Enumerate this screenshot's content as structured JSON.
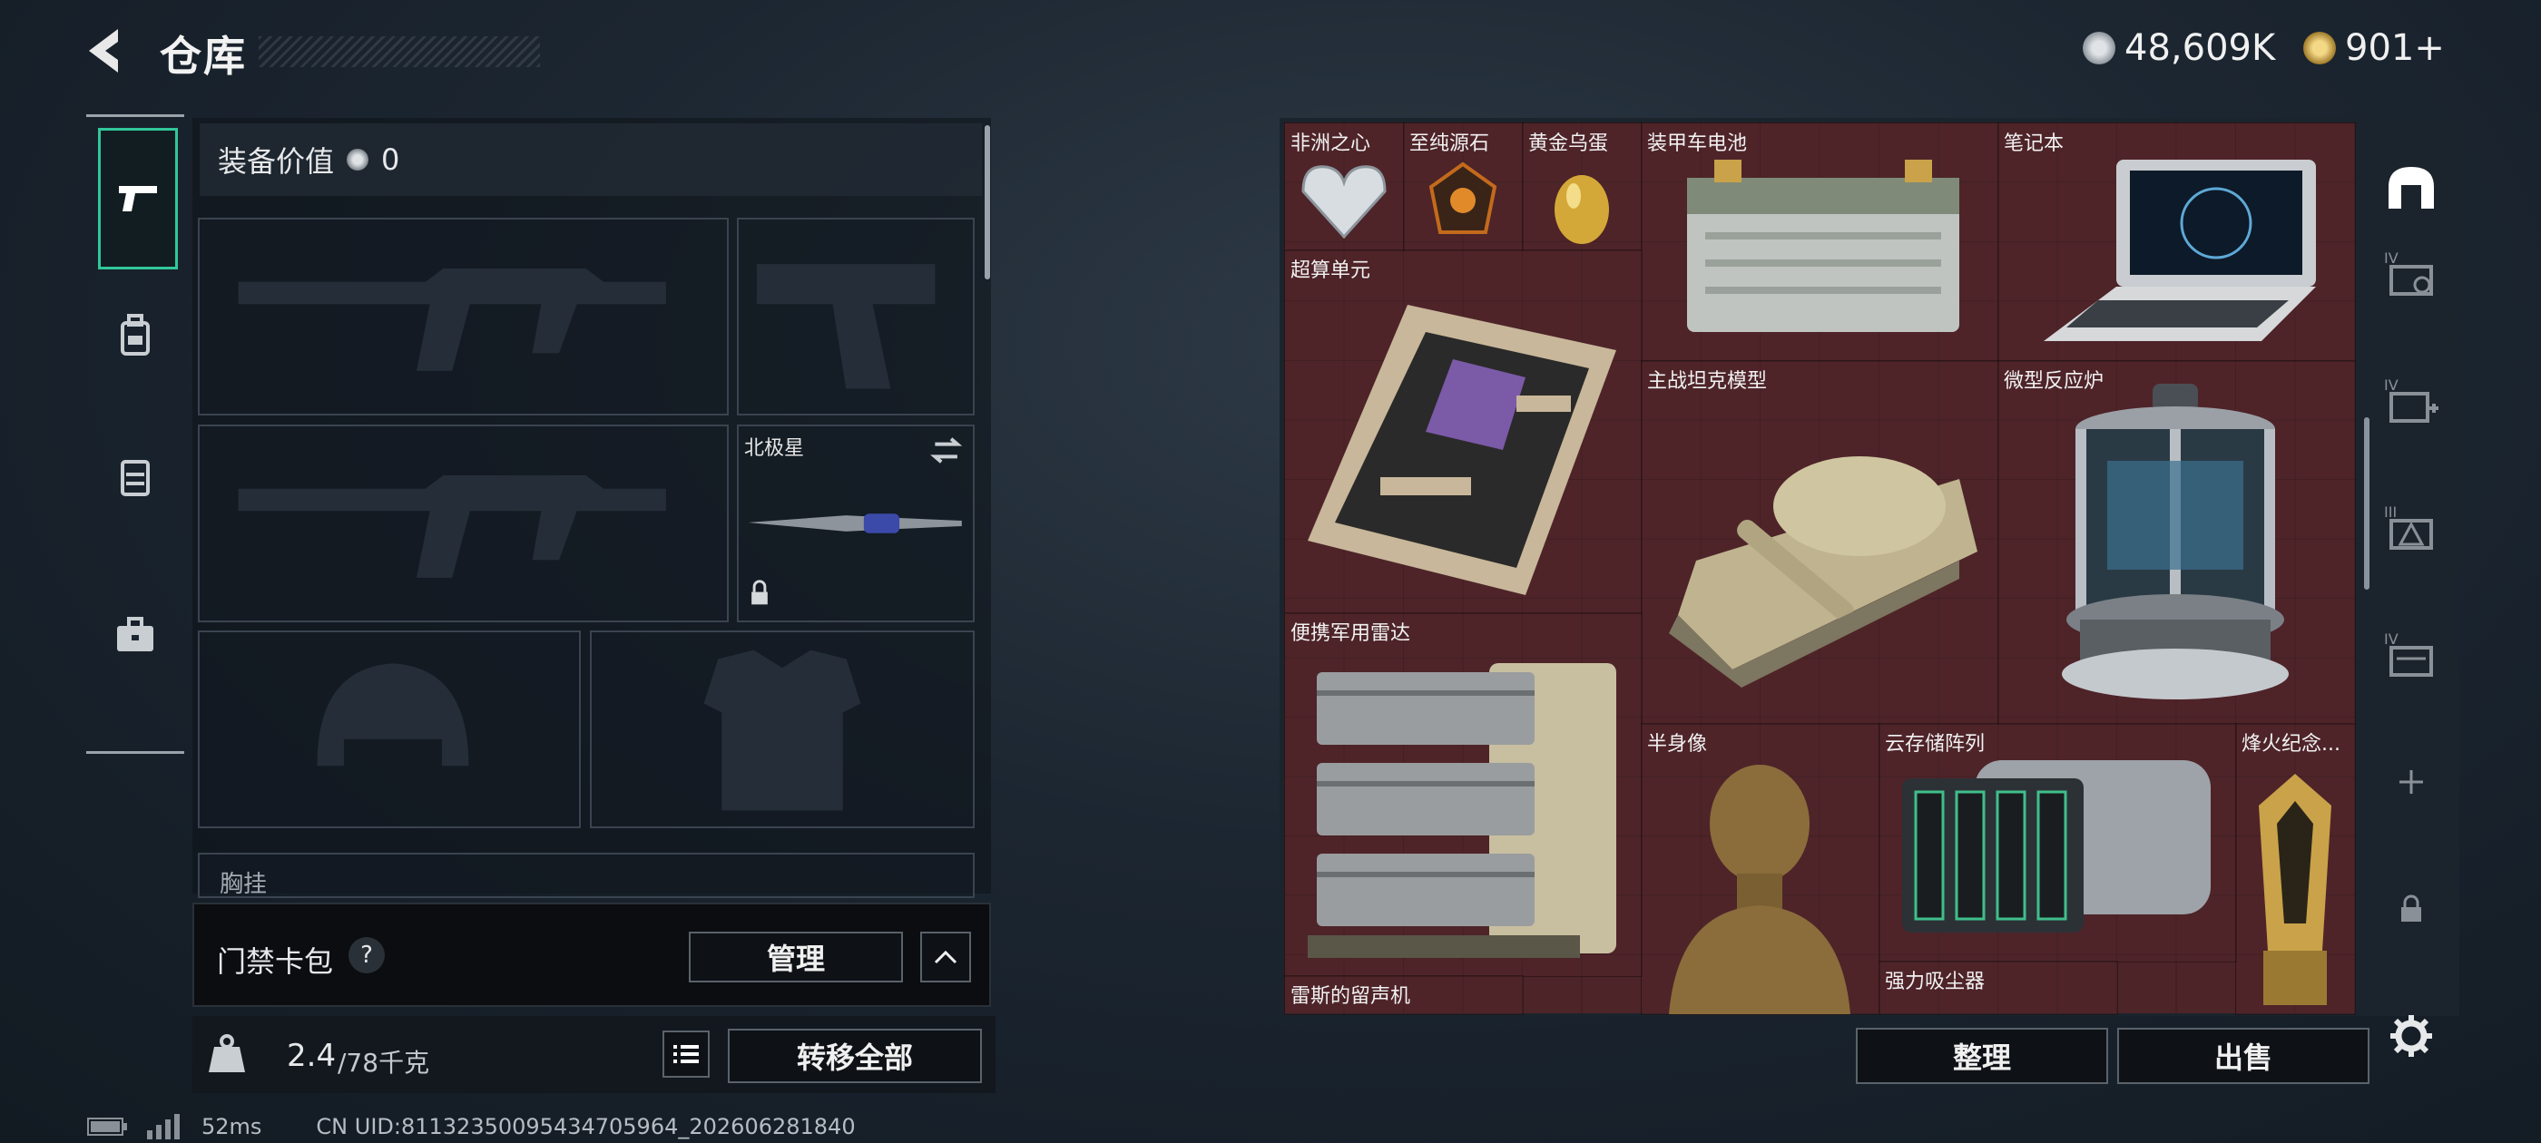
{
  "header": {
    "title": "仓库",
    "currency_silver": "48,609K",
    "currency_gold": "901+"
  },
  "nav": {
    "items": [
      {
        "id": "weapons",
        "icon": "pistol-icon",
        "active": true
      },
      {
        "id": "armor",
        "icon": "backpack-icon",
        "active": false
      },
      {
        "id": "rig",
        "icon": "vest-icon",
        "active": false
      },
      {
        "id": "case",
        "icon": "toolbox-icon",
        "active": false
      }
    ]
  },
  "equipment": {
    "value_label": "装备价值",
    "value": "0",
    "melee_name": "北极星",
    "chest_rig_label": "胸挂",
    "help": "?"
  },
  "keycard": {
    "label": "门禁卡包",
    "help": "?",
    "manage_label": "管理"
  },
  "weight": {
    "current": "2.4",
    "max": "/78千克",
    "kg_icon": "KG",
    "transfer_label": "转移全部"
  },
  "stash": {
    "items": [
      {
        "name": "非洲之心",
        "color": "#d8dde2"
      },
      {
        "name": "至纯源石",
        "color": "#c46a1c"
      },
      {
        "name": "黄金乌蛋",
        "color": "#d4a838"
      },
      {
        "name": "装甲车电池",
        "color": "#bfc4c0"
      },
      {
        "name": "笔记本",
        "color": "#c9ccd0"
      },
      {
        "name": "超算单元",
        "color": "#c8b79a"
      },
      {
        "name": "主战坦克模型",
        "color": "#bfb48f"
      },
      {
        "name": "微型反应炉",
        "color": "#9aa0a6"
      },
      {
        "name": "便携军用雷达",
        "color": "#c8bfa0"
      },
      {
        "name": "半身像",
        "color": "#8a6d3b"
      },
      {
        "name": "云存储阵列",
        "color": "#9da3a8"
      },
      {
        "name": "烽火纪念...",
        "color": "#c9a24a"
      },
      {
        "name": "雷斯的留声机",
        "color": ""
      },
      {
        "name": "强力吸尘器",
        "color": ""
      }
    ],
    "sort_label": "整理",
    "sell_label": "出售"
  },
  "status": {
    "ping": "52ms",
    "uid": "CN UID:81132350095434705964_202606281840"
  },
  "colors": {
    "accent_green": "#31c79a",
    "grid_bg": "#4d2428"
  }
}
